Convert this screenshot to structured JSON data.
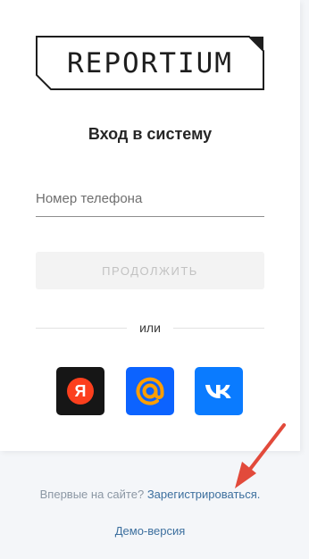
{
  "brand": {
    "logo_text": "REPORTIUM"
  },
  "login": {
    "title": "Вход в систему",
    "phone_placeholder": "Номер телефона",
    "continue_label": "ПРОДОЛЖИТЬ",
    "or_label": "или"
  },
  "social": [
    {
      "name": "yandex",
      "glyph": "Я",
      "color": "#161616",
      "accent": "#fc3f1d"
    },
    {
      "name": "mail",
      "glyph": "@",
      "color": "#0c63ff",
      "accent": "#ff9e00"
    },
    {
      "name": "vk",
      "glyph": "VK",
      "color": "#0a7bff",
      "accent": "#ffffff"
    }
  ],
  "footer": {
    "new_label": "Впервые на сайте?",
    "register_label": "Зарегистрироваться.",
    "demo_label": "Демо-версия"
  },
  "colors": {
    "background": "#f4f6f9",
    "card": "#ffffff",
    "link": "#3c6f9e",
    "annotation_arrow": "#e24a3b"
  }
}
